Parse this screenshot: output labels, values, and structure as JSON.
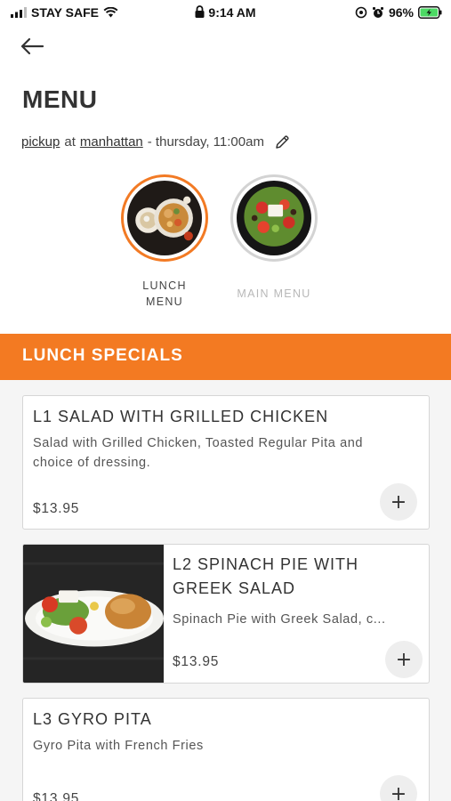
{
  "status_bar": {
    "carrier": "STAY SAFE",
    "time": "9:14 AM",
    "battery": "96%"
  },
  "header": {
    "title": "MENU"
  },
  "order_info": {
    "mode": "pickup",
    "at_text": "at",
    "location": "manhattan",
    "schedule": "- thursday, 11:00am"
  },
  "categories": [
    {
      "label_line1": "LUNCH",
      "label_line2": "MENU",
      "active": true
    },
    {
      "label_line1": "MAIN MENU",
      "label_line2": "",
      "active": false
    }
  ],
  "section": {
    "title": "LUNCH SPECIALS"
  },
  "items": [
    {
      "title": "L1 SALAD WITH GRILLED CHICKEN",
      "description": "Salad with Grilled Chicken, Toasted Regular Pita and choice of dressing.",
      "price": "$13.95",
      "add_label": "+"
    },
    {
      "title": "L2 SPINACH PIE WITH GREEK SALAD",
      "description": "Spinach Pie with Greek Salad, c...",
      "price": "$13.95",
      "add_label": "+"
    },
    {
      "title": "L3 GYRO PITA",
      "description": "Gyro Pita with French Fries",
      "price": "$13.95",
      "add_label": "+"
    }
  ],
  "colors": {
    "accent": "#f37a22",
    "battery": "#4cd964"
  }
}
